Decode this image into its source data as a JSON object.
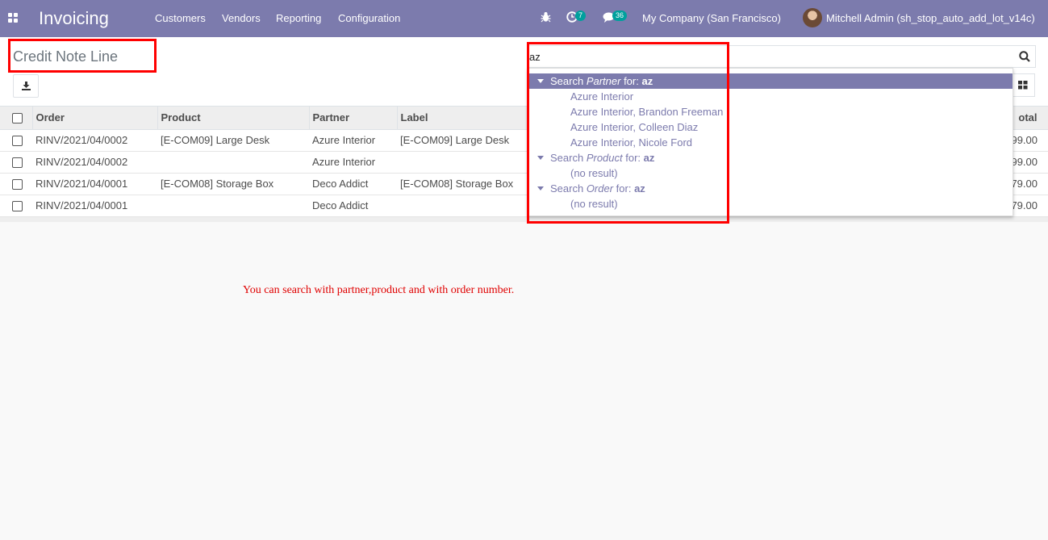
{
  "navbar": {
    "app_name": "Invoicing",
    "menu": [
      "Customers",
      "Vendors",
      "Reporting",
      "Configuration"
    ],
    "activity_count": "7",
    "messages_count": "36",
    "company": "My Company (San Francisco)",
    "user": "Mitchell Admin (sh_stop_auto_add_lot_v14c)"
  },
  "control_panel": {
    "title": "Credit Note Line",
    "search_value": "az"
  },
  "table": {
    "columns": [
      "Order",
      "Product",
      "Partner",
      "Label",
      "Total"
    ],
    "total_header_visible": "otal",
    "rows": [
      {
        "order": "RINV/2021/04/0002",
        "product": "[E-COM09] Large Desk",
        "partner": "Azure Interior",
        "label": "[E-COM09] Large Desk",
        "total": "799.00"
      },
      {
        "order": "RINV/2021/04/0002",
        "product": "",
        "partner": "Azure Interior",
        "label": "",
        "total": "799.00"
      },
      {
        "order": "RINV/2021/04/0001",
        "product": "[E-COM08] Storage Box",
        "partner": "Deco Addict",
        "label": "[E-COM08] Storage Box",
        "total": "79.00"
      },
      {
        "order": "RINV/2021/04/0001",
        "product": "",
        "partner": "Deco Addict",
        "label": "",
        "total": "-79.00"
      }
    ]
  },
  "dropdown": {
    "partner_prefix": "Search ",
    "partner_field": "Partner",
    "partner_suffix": " for: ",
    "query": "az",
    "partner_results": [
      "Azure Interior",
      "Azure Interior, Brandon Freeman",
      "Azure Interior, Colleen Diaz",
      "Azure Interior, Nicole Ford"
    ],
    "product_field": "Product",
    "product_result": "(no result)",
    "order_field": "Order",
    "order_result": "(no result)"
  },
  "note": "You can search with partner,product and with order number.",
  "colors": {
    "brand": "#7c7bad",
    "badge": "#00a09d",
    "highlight": "#ff0000"
  }
}
